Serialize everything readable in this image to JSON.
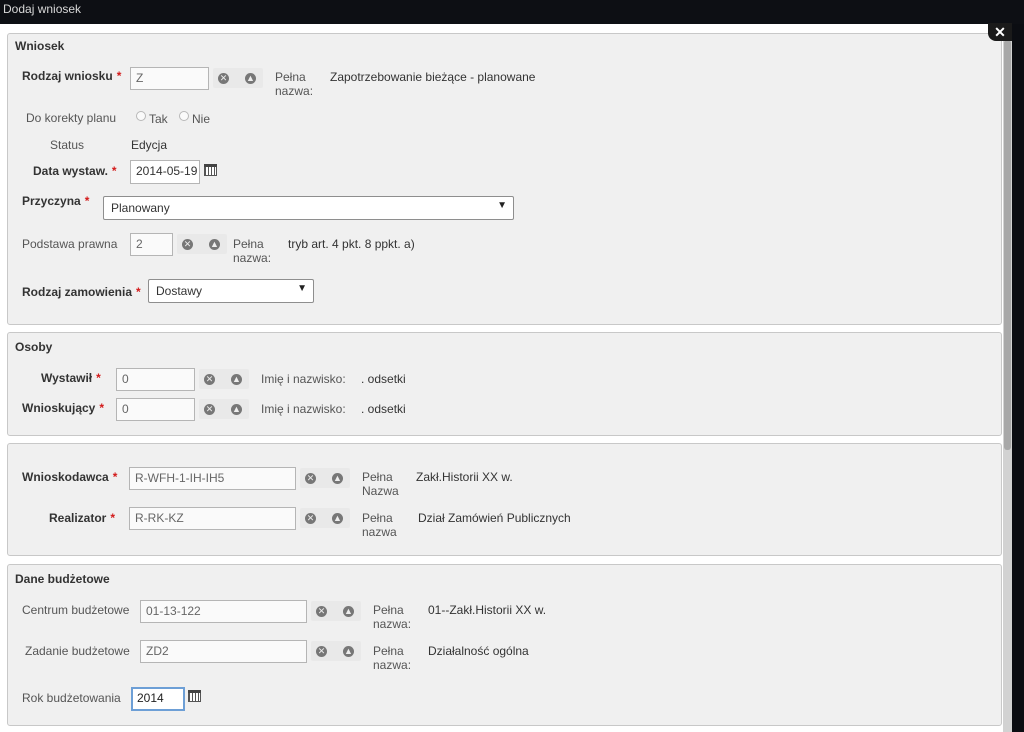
{
  "window": {
    "title": "Dodaj wniosek",
    "close_glyph": "✕"
  },
  "wniosek": {
    "legend": "Wniosek",
    "rodzaj_wniosku": {
      "label": "Rodzaj wniosku",
      "value": "Z",
      "pelna_label_1": "Pełna",
      "pelna_label_2": "nazwa:",
      "pelna_value": "Zapotrzebowanie bieżące - planowane"
    },
    "do_korekty": {
      "label": "Do korekty planu",
      "opt_tak": "Tak",
      "opt_nie": "Nie"
    },
    "status": {
      "label": "Status",
      "value": "Edycja"
    },
    "data_wystaw": {
      "label": "Data wystaw.",
      "value": "2014-05-19"
    },
    "przyczyna": {
      "label": "Przyczyna",
      "value": "Planowany"
    },
    "podstawa": {
      "label": "Podstawa prawna",
      "value": "2",
      "pelna_label_1": "Pełna",
      "pelna_label_2": "nazwa:",
      "pelna_value": "tryb art. 4 pkt. 8 ppkt. a)"
    },
    "rodzaj_zamowienia": {
      "label": "Rodzaj zamowienia",
      "value": "Dostawy"
    }
  },
  "osoby": {
    "legend": "Osoby",
    "wystawil": {
      "label": "Wystawił",
      "value": "0",
      "imie_label": "Imię i nazwisko:",
      "imie_value": ". odsetki"
    },
    "wnioskujacy": {
      "label": "Wnioskujący",
      "value": "0",
      "imie_label": "Imię i nazwisko:",
      "imie_value": ". odsetki"
    }
  },
  "jednostki": {
    "wnioskodawca": {
      "label": "Wnioskodawca",
      "value": "R-WFH-1-IH-IH5",
      "pelna_label_1": "Pełna",
      "pelna_label_2": "Nazwa",
      "pelna_value": "Zakł.Historii XX w."
    },
    "realizator": {
      "label": "Realizator",
      "value": "R-RK-KZ",
      "pelna_label_1": "Pełna",
      "pelna_label_2": "nazwa",
      "pelna_value": "Dział Zamówień Publicznych"
    }
  },
  "budzet": {
    "legend": "Dane budżetowe",
    "centrum": {
      "label": "Centrum budżetowe",
      "value": "01-13-122",
      "pelna_label_1": "Pełna",
      "pelna_label_2": "nazwa:",
      "pelna_value": "01--Zakł.Historii XX w."
    },
    "zadanie": {
      "label": "Zadanie budżetowe",
      "value": "ZD2",
      "pelna_label_1": "Pełna",
      "pelna_label_2": "nazwa:",
      "pelna_value": "Działalność ogólna"
    },
    "rok": {
      "label": "Rok budżetowania",
      "value": "2014"
    }
  },
  "common": {
    "required_mark": "*",
    "clear_glyph": "✕",
    "lookup_glyph": "▲",
    "dropdown_glyph": "▼"
  }
}
